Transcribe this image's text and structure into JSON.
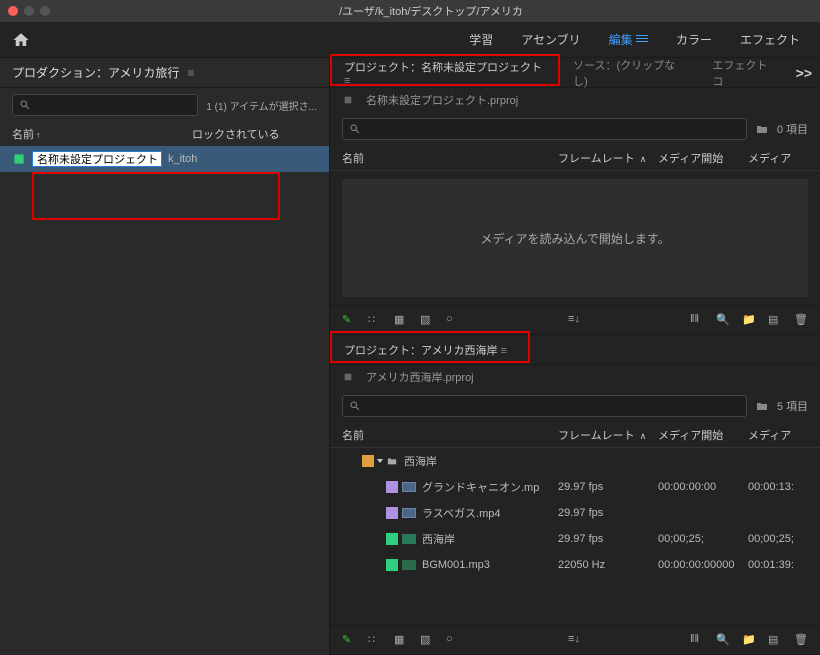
{
  "titlebar": {
    "path": "/ユーザ/k_itoh/デスクトップ/アメリカ"
  },
  "topnav": {
    "items": [
      "学習",
      "アセンブリ",
      "編集",
      "カラー",
      "エフェクト"
    ],
    "active_index": 2
  },
  "left_panel": {
    "title": "プロダクション：アメリカ旅行",
    "selection_text": "1 (1) アイテムが選択さ...",
    "col_name": "名前",
    "col_lock": "ロックされている",
    "editing_value": "名称未設定プロジェクト",
    "edit_user": "k_itoh"
  },
  "tabs": {
    "project": "プロジェクト：名称未設定プロジェクト",
    "source": "ソース：(クリップなし)",
    "effects": "エフェクトコ",
    "more": ">>"
  },
  "project1": {
    "crumb": "名称未設定プロジェクト.prproj",
    "item_count": "0 項目",
    "cols": {
      "name": "名前",
      "frame": "フレームレート",
      "start": "メディア開始",
      "dur": "メディア"
    },
    "empty_msg": "メディアを読み込んで開始します。"
  },
  "tabs2": {
    "project": "プロジェクト：アメリカ西海岸"
  },
  "project2": {
    "crumb": "アメリカ西海岸.prproj",
    "item_count": "5 項目",
    "cols": {
      "name": "名前",
      "frame": "フレームレート",
      "start": "メディア開始",
      "dur": "メディア"
    },
    "bin": "西海岸",
    "rows": [
      {
        "swatch": "purple",
        "type": "clip",
        "name": "グランドキャニオン.mp",
        "frame": "29.97 fps",
        "start": "00:00:00:00",
        "dur": "00:00:13:"
      },
      {
        "swatch": "purple",
        "type": "clip",
        "name": "ラスベガス.mp4",
        "frame": "29.97 fps",
        "start": "",
        "dur": ""
      },
      {
        "swatch": "green",
        "type": "seq",
        "name": "西海岸",
        "frame": "29.97 fps",
        "start": "00;00;25;",
        "dur": "00;00;25;"
      },
      {
        "swatch": "green",
        "type": "audio",
        "name": "BGM001.mp3",
        "frame": "22050 Hz",
        "start": "00:00:00:00000",
        "dur": "00:01:39:"
      }
    ]
  }
}
